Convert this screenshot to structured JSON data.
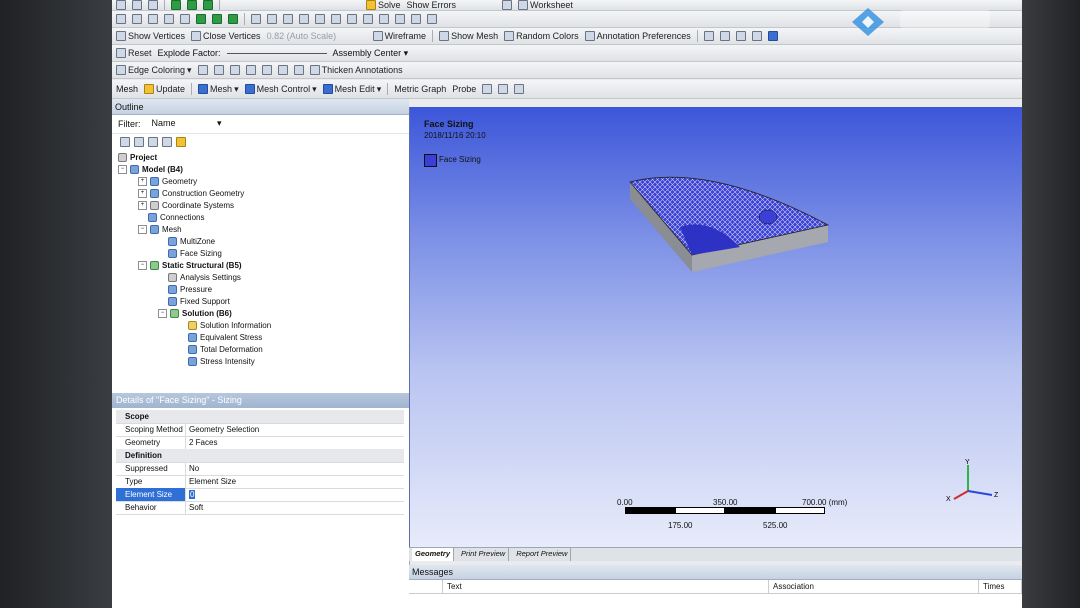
{
  "toolbar1": {
    "solve": "Solve",
    "show_errors": "Show Errors",
    "worksheet": "Worksheet"
  },
  "toolbar2": {
    "show_vertices": "Show Vertices",
    "close_vertices": "Close Vertices",
    "auto_scale": "0.82 (Auto Scale)",
    "wireframe": "Wireframe",
    "show_mesh": "Show Mesh",
    "random_colors": "Random Colors",
    "annotation_prefs": "Annotation Preferences"
  },
  "toolbar3": {
    "reset": "Reset",
    "explode_factor": "Explode Factor:",
    "assembly_center": "Assembly Center"
  },
  "toolbar4": {
    "edge_coloring": "Edge Coloring",
    "thicken": "Thicken Annotations"
  },
  "toolbar5": {
    "mesh": "Mesh",
    "update": "Update",
    "mesh_dd": "Mesh",
    "mesh_control": "Mesh Control",
    "mesh_edit": "Mesh Edit",
    "metric_graph": "Metric Graph",
    "probe": "Probe"
  },
  "outline": {
    "title": "Outline",
    "filter_label": "Filter:",
    "filter_value": "Name"
  },
  "tree": [
    "Project",
    "Model (B4)",
    "Geometry",
    "Construction Geometry",
    "Coordinate Systems",
    "Connections",
    "Mesh",
    "MultiZone",
    "Face Sizing",
    "Static Structural (B5)",
    "Analysis Settings",
    "Pressure",
    "Fixed Support",
    "Solution (B6)",
    "Solution Information",
    "Equivalent Stress",
    "Total Deformation",
    "Stress Intensity"
  ],
  "details": {
    "title": "Details of \"Face Sizing\" - Sizing",
    "scope": "Scope",
    "scoping_method_k": "Scoping Method",
    "scoping_method_v": "Geometry Selection",
    "geometry_k": "Geometry",
    "geometry_v": "2 Faces",
    "definition": "Definition",
    "suppressed_k": "Suppressed",
    "suppressed_v": "No",
    "type_k": "Type",
    "type_v": "Element Size",
    "element_size_k": "Element Size",
    "element_size_v": "0",
    "behavior_k": "Behavior",
    "behavior_v": "Soft"
  },
  "viewport": {
    "title": "Face Sizing",
    "date": "2018/11/16 20:10",
    "legend": "Face Sizing"
  },
  "scale": {
    "l0": "0.00",
    "l1": "350.00",
    "l2": "700.00 (mm)",
    "l3": "175.00",
    "l4": "525.00"
  },
  "tabs": [
    "Geometry",
    "Print Preview",
    "Report Preview"
  ],
  "messages": {
    "title": "Messages",
    "col_text": "Text",
    "col_assoc": "Association",
    "col_time": "Times"
  },
  "colors": {
    "viewport_top": "#3c56d9",
    "mesh_face": "#3a3fd6"
  }
}
